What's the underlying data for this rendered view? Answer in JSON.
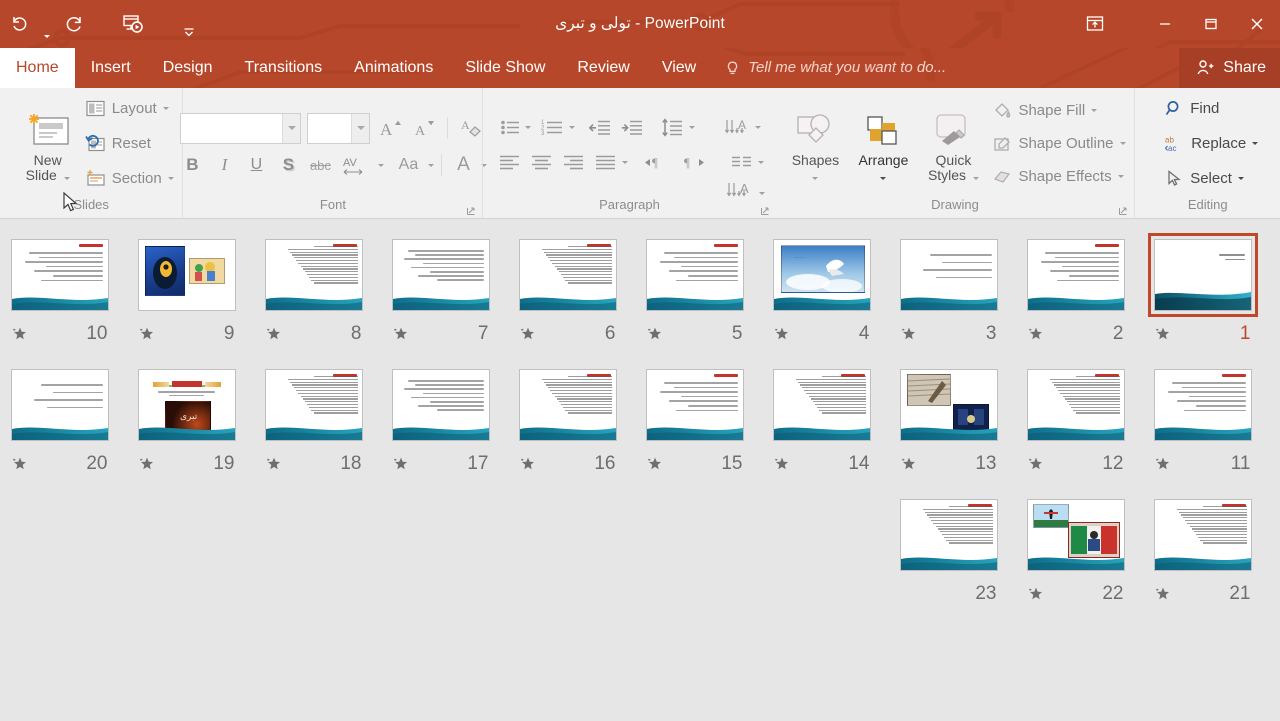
{
  "window": {
    "title": "تولی و تبری - PowerPoint",
    "quick_access": [
      {
        "name": "undo-icon",
        "label": "Undo"
      },
      {
        "name": "redo-icon",
        "label": "Redo"
      },
      {
        "name": "start-from-beginning-icon",
        "label": "Start From Beginning"
      },
      {
        "name": "customize-quick-access-toolbar-icon",
        "label": "Customize Quick Access Toolbar"
      }
    ],
    "controls": [
      {
        "name": "ribbon-display-options-icon",
        "label": "Ribbon Display Options"
      },
      {
        "name": "minimize-icon",
        "label": "Minimize"
      },
      {
        "name": "restore-icon",
        "label": "Restore Down"
      },
      {
        "name": "close-icon",
        "label": "Close"
      }
    ]
  },
  "tabs": [
    {
      "label": "Home",
      "active": true
    },
    {
      "label": "Insert",
      "active": false
    },
    {
      "label": "Design",
      "active": false
    },
    {
      "label": "Transitions",
      "active": false
    },
    {
      "label": "Animations",
      "active": false
    },
    {
      "label": "Slide Show",
      "active": false
    },
    {
      "label": "Review",
      "active": false
    },
    {
      "label": "View",
      "active": false
    }
  ],
  "tell_me": {
    "placeholder": "Tell me what you want to do...",
    "icon": "lightbulb-icon"
  },
  "share": {
    "label": "Share",
    "icon": "share-person-icon"
  },
  "ribbon": {
    "groups": [
      {
        "label": "Slides",
        "big_button": {
          "label_line1": "New",
          "label_line2": "Slide",
          "icon": "new-slide-icon",
          "has_dropdown": true
        },
        "items": [
          {
            "label": "Layout",
            "icon": "layout-icon",
            "has_dropdown": true
          },
          {
            "label": "Reset",
            "icon": "reset-icon",
            "has_dropdown": false
          },
          {
            "label": "Section",
            "icon": "section-icon",
            "has_dropdown": true
          }
        ],
        "has_dialog_launcher": false
      },
      {
        "label": "Font",
        "font_name": {
          "value": "",
          "placeholder": ""
        },
        "font_size": {
          "value": "",
          "placeholder": ""
        },
        "items": [
          {
            "label": "Increase Font Size",
            "icon": "increase-font-size-icon"
          },
          {
            "label": "Decrease Font Size",
            "icon": "decrease-font-size-icon"
          },
          {
            "label": "Clear All Formatting",
            "icon": "clear-formatting-icon"
          },
          {
            "label": "Bold",
            "icon": "bold-icon"
          },
          {
            "label": "Italic",
            "icon": "italic-icon"
          },
          {
            "label": "Underline",
            "icon": "underline-icon"
          },
          {
            "label": "Text Shadow",
            "icon": "text-shadow-icon"
          },
          {
            "label": "Strikethrough",
            "icon": "strikethrough-icon"
          },
          {
            "label": "Character Spacing",
            "icon": "character-spacing-icon"
          },
          {
            "label": "Change Case",
            "icon": "change-case-icon"
          },
          {
            "label": "Font Color",
            "icon": "font-color-icon"
          }
        ],
        "has_dialog_launcher": true
      },
      {
        "label": "Paragraph",
        "items": [
          {
            "label": "Bullets",
            "icon": "bullets-icon"
          },
          {
            "label": "Numbering",
            "icon": "numbering-icon"
          },
          {
            "label": "Decrease List Level",
            "icon": "decrease-indent-icon"
          },
          {
            "label": "Increase List Level",
            "icon": "increase-indent-icon"
          },
          {
            "label": "Line Spacing",
            "icon": "line-spacing-icon"
          },
          {
            "label": "Text Direction",
            "icon": "text-direction-icon"
          },
          {
            "label": "Align Text",
            "icon": "align-text-icon"
          },
          {
            "label": "Convert to SmartArt",
            "icon": "smartart-icon"
          },
          {
            "label": "Align Left",
            "icon": "align-left-icon"
          },
          {
            "label": "Center",
            "icon": "align-center-icon"
          },
          {
            "label": "Align Right",
            "icon": "align-right-icon"
          },
          {
            "label": "Justify",
            "icon": "justify-icon"
          },
          {
            "label": "Left-to-Right Text Direction",
            "icon": "ltr-icon"
          },
          {
            "label": "Right-to-Left Text Direction",
            "icon": "rtl-icon"
          },
          {
            "label": "Columns",
            "icon": "columns-icon"
          }
        ],
        "has_dialog_launcher": true
      },
      {
        "label": "Drawing",
        "items": [
          {
            "label": "Shapes",
            "icon": "shapes-icon",
            "has_dropdown": true
          },
          {
            "label": "Arrange",
            "icon": "arrange-icon",
            "has_dropdown": true
          },
          {
            "label_line1": "Quick",
            "label_line2": "Styles",
            "icon": "quick-styles-icon",
            "has_dropdown": true
          },
          {
            "label": "Shape Fill",
            "icon": "shape-fill-icon",
            "has_dropdown": true
          },
          {
            "label": "Shape Outline",
            "icon": "shape-outline-icon",
            "has_dropdown": true
          },
          {
            "label": "Shape Effects",
            "icon": "shape-effects-icon",
            "has_dropdown": true
          }
        ],
        "has_dialog_launcher": true
      },
      {
        "label": "Editing",
        "items": [
          {
            "label": "Find",
            "icon": "find-icon",
            "has_dropdown": false
          },
          {
            "label": "Replace",
            "icon": "replace-icon",
            "has_dropdown": true
          },
          {
            "label": "Select",
            "icon": "select-icon",
            "has_dropdown": true
          }
        ],
        "has_dialog_launcher": false
      }
    ]
  },
  "colors": {
    "accent": "#b7472a",
    "accent_dark": "#a63f25",
    "selection": "#c0482a",
    "ribbon_bg": "#f1f1f1",
    "sorter_bg": "#e6e6e6",
    "slide_footer": "#1b7f96"
  },
  "slide_sorter": {
    "view": "Slide Sorter",
    "reading_direction": "right-to-left",
    "selected_slide": 1,
    "rows": [
      [
        {
          "number": "10",
          "animated": true,
          "selected": false,
          "kind": "text"
        },
        {
          "number": "9",
          "animated": true,
          "selected": false,
          "kind": "two-images"
        },
        {
          "number": "8",
          "animated": true,
          "selected": false,
          "kind": "dense-text"
        },
        {
          "number": "7",
          "animated": true,
          "selected": false,
          "kind": "text-no-title"
        },
        {
          "number": "6",
          "animated": true,
          "selected": false,
          "kind": "dense-text"
        },
        {
          "number": "5",
          "animated": true,
          "selected": false,
          "kind": "text"
        },
        {
          "number": "4",
          "animated": true,
          "selected": false,
          "kind": "photo-sky"
        },
        {
          "number": "3",
          "animated": true,
          "selected": false,
          "kind": "text-sparse"
        },
        {
          "number": "2",
          "animated": true,
          "selected": false,
          "kind": "text"
        },
        {
          "number": "1",
          "animated": true,
          "selected": true,
          "kind": "title"
        }
      ],
      [
        {
          "number": "20",
          "animated": true,
          "selected": false,
          "kind": "text-sparse"
        },
        {
          "number": "19",
          "animated": true,
          "selected": false,
          "kind": "banner-dark"
        },
        {
          "number": "18",
          "animated": true,
          "selected": false,
          "kind": "dense-text"
        },
        {
          "number": "17",
          "animated": true,
          "selected": false,
          "kind": "text-no-title"
        },
        {
          "number": "16",
          "animated": true,
          "selected": false,
          "kind": "dense-text"
        },
        {
          "number": "15",
          "animated": true,
          "selected": false,
          "kind": "text"
        },
        {
          "number": "14",
          "animated": true,
          "selected": false,
          "kind": "dense-text"
        },
        {
          "number": "13",
          "animated": true,
          "selected": false,
          "kind": "two-photos"
        },
        {
          "number": "12",
          "animated": true,
          "selected": false,
          "kind": "dense-text"
        },
        {
          "number": "11",
          "animated": true,
          "selected": false,
          "kind": "text"
        }
      ],
      [
        {
          "number": "23",
          "animated": false,
          "selected": false,
          "kind": "dense-text"
        },
        {
          "number": "22",
          "animated": true,
          "selected": false,
          "kind": "sport-photos"
        },
        {
          "number": "21",
          "animated": true,
          "selected": false,
          "kind": "dense-text"
        }
      ]
    ]
  }
}
